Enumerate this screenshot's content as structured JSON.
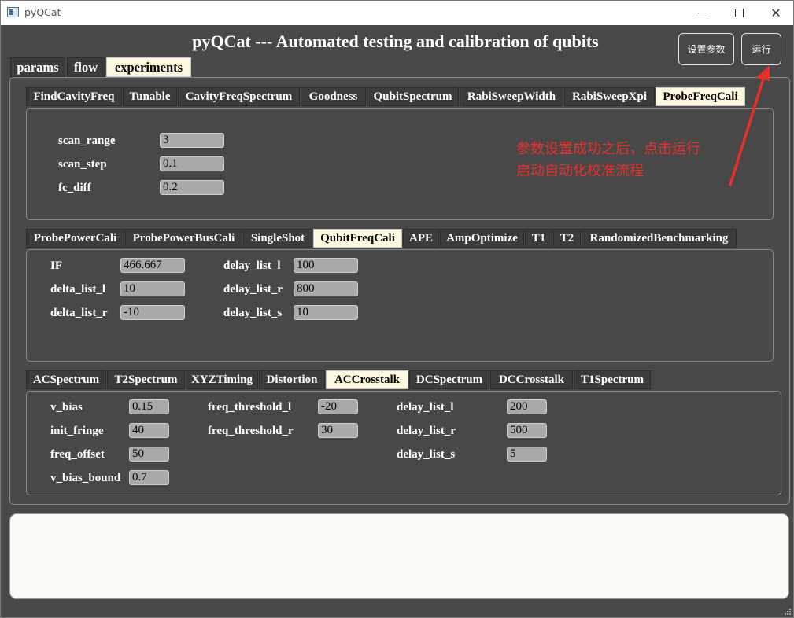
{
  "window": {
    "title": "pyQCat"
  },
  "header": {
    "title": "pyQCat --- Automated testing and calibration of qubits",
    "settings_button": "设置参数",
    "run_button": "运行"
  },
  "main_tabs": [
    "params",
    "flow",
    "experiments"
  ],
  "group1": {
    "tabs": [
      "FindCavityFreq",
      "Tunable",
      "CavityFreqSpectrum",
      "Goodness",
      "QubitSpectrum",
      "RabiSweepWidth",
      "RabiSweepXpi",
      "ProbeFreqCali"
    ],
    "fields": [
      {
        "label": "scan_range",
        "value": "3"
      },
      {
        "label": "scan_step",
        "value": "0.1"
      },
      {
        "label": "fc_diff",
        "value": "0.2"
      }
    ]
  },
  "group2": {
    "tabs": [
      "ProbePowerCali",
      "ProbePowerBusCali",
      "SingleShot",
      "QubitFreqCali",
      "APE",
      "AmpOptimize",
      "T1",
      "T2",
      "RandomizedBenchmarking"
    ],
    "fields": [
      {
        "label": "IF",
        "value": "466.667"
      },
      {
        "label": "delta_list_l",
        "value": "10"
      },
      {
        "label": "delta_list_r",
        "value": "-10"
      },
      {
        "label": "delay_list_l",
        "value": "100"
      },
      {
        "label": "delay_list_r",
        "value": "800"
      },
      {
        "label": "delay_list_s",
        "value": "10"
      }
    ]
  },
  "group3": {
    "tabs": [
      "ACSpectrum",
      "T2Spectrum",
      "XYZTiming",
      "Distortion",
      "ACCrosstalk",
      "DCSpectrum",
      "DCCrosstalk",
      "T1Spectrum"
    ],
    "fields": [
      {
        "label": "v_bias",
        "value": "0.15"
      },
      {
        "label": "init_fringe",
        "value": "40"
      },
      {
        "label": "freq_offset",
        "value": "50"
      },
      {
        "label": "v_bias_bound",
        "value": "0.7"
      },
      {
        "label": "freq_threshold_l",
        "value": "-20"
      },
      {
        "label": "freq_threshold_r",
        "value": "30"
      },
      {
        "label": "delay_list_l",
        "value": "200"
      },
      {
        "label": "delay_list_r",
        "value": "500"
      },
      {
        "label": "delay_list_s",
        "value": "5"
      }
    ]
  },
  "annotation": {
    "line1": "参数设置成功之后，点击运行",
    "line2": "启动自动化校准流程",
    "color": "#e8302b"
  },
  "log": {
    "text": ""
  },
  "colors": {
    "background": "#484848",
    "active_tab": "#fff8e1",
    "input": "#a9a9a9"
  }
}
